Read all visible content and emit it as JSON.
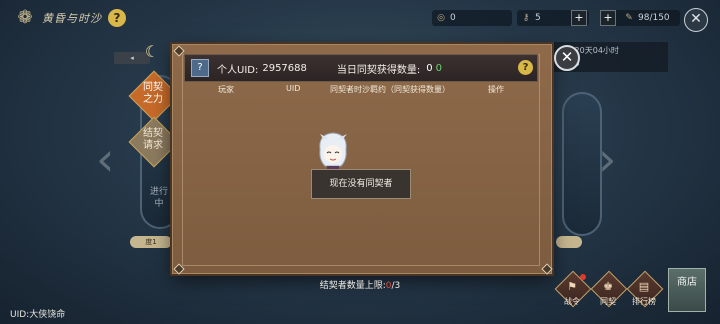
{
  "topbar": {
    "title": "黄昏与时沙",
    "resources": [
      {
        "icon": "sand-icon",
        "value": "0"
      },
      {
        "icon": "key-icon",
        "value": "5"
      },
      {
        "icon": "feather-icon",
        "value": "98/150"
      }
    ]
  },
  "info_panel": {
    "row1_label": "",
    "row1_value": "20天04小时",
    "row2_label": "",
    "row2_value": "0"
  },
  "side_tabs": [
    {
      "label_line1": "同契",
      "label_line2": "之力",
      "active": true
    },
    {
      "label_line1": "结契",
      "label_line2": "请求",
      "active": false
    }
  ],
  "left_card": {
    "status": "进行中",
    "progress": "度1"
  },
  "dialog": {
    "uid_label": "个人UID:",
    "uid_value": "2957688",
    "count_label": "当日同契获得数量:",
    "count_value": "0",
    "count_green": "0",
    "columns": [
      "玩家",
      "UID",
      "同契者时沙羁约（同契获得数量）",
      "操作"
    ],
    "empty_message": "现在没有同契者",
    "limit_label": "结契者数量上限:",
    "limit_current": "0",
    "limit_max": "/3"
  },
  "footer": {
    "uid_text": "UID:大侠饶命",
    "buttons": [
      {
        "label": "战令",
        "icon": "battle-pass-icon"
      },
      {
        "label": "同契",
        "icon": "bond-icon"
      },
      {
        "label": "排行榜",
        "icon": "ranking-icon"
      }
    ],
    "shop_label": "商店"
  }
}
